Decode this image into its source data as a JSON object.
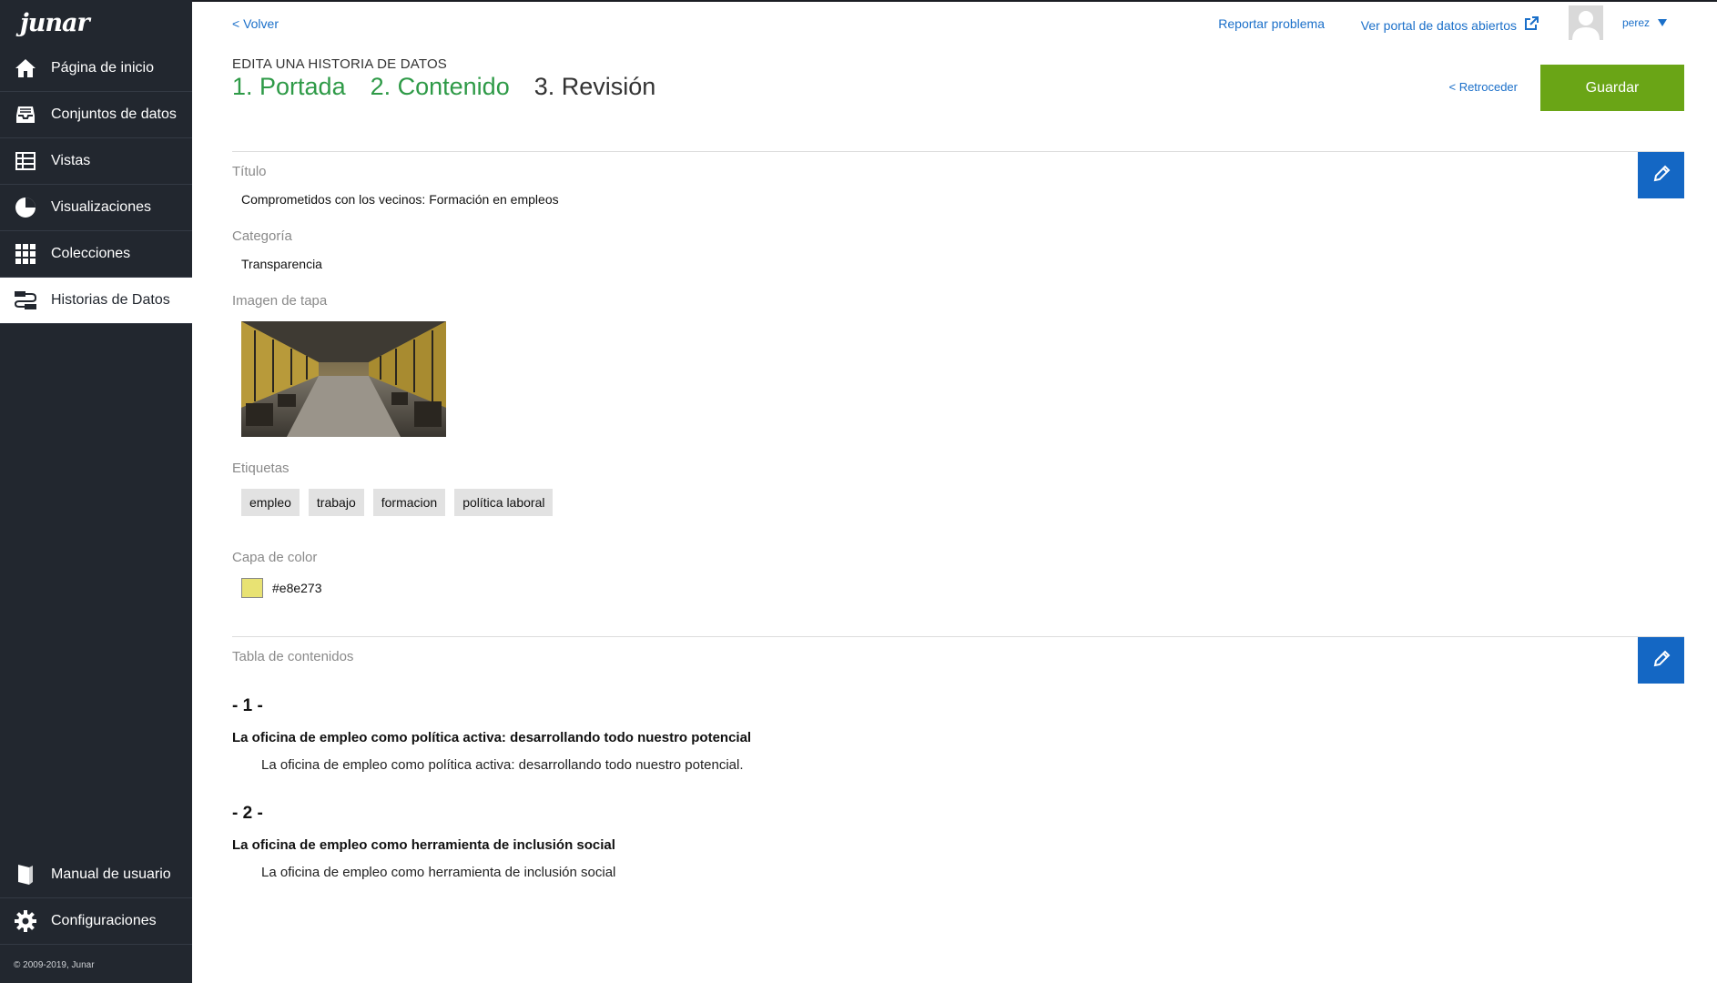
{
  "brand": {
    "logo_text": "junar"
  },
  "sidebar": {
    "items": [
      {
        "label": "Página de inicio",
        "icon": "home-icon"
      },
      {
        "label": "Conjuntos de datos",
        "icon": "inbox-icon"
      },
      {
        "label": "Vistas",
        "icon": "table-icon"
      },
      {
        "label": "Visualizaciones",
        "icon": "pie-chart-icon"
      },
      {
        "label": "Colecciones",
        "icon": "grid-icon"
      },
      {
        "label": "Historias de Datos",
        "icon": "story-icon",
        "active": true
      }
    ],
    "bottom_items": [
      {
        "label": "Manual de usuario",
        "icon": "book-icon"
      },
      {
        "label": "Configuraciones",
        "icon": "gear-icon"
      }
    ],
    "copyright": "© 2009-2019, Junar"
  },
  "header": {
    "back_label": "< Volver",
    "report_label": "Reportar problema",
    "portal_label": "Ver portal de datos abiertos",
    "username": "perez",
    "edit_label": "EDITA UNA HISTORIA DE DATOS",
    "steps": [
      "1. Portada",
      "2. Contenido",
      "3. Revisión"
    ],
    "back_step_label": "< Retroceder",
    "save_label": "Guardar"
  },
  "cover": {
    "title_label": "Título",
    "title_value": "Comprometidos con los vecinos: Formación en empleos",
    "category_label": "Categoría",
    "category_value": "Transparencia",
    "image_label": "Imagen de tapa",
    "tags_label": "Etiquetas",
    "tags": [
      "empleo",
      "trabajo",
      "formacion",
      "política laboral"
    ],
    "color_label": "Capa de color",
    "color_value": "#e8e273"
  },
  "toc": {
    "label": "Tabla de contenidos",
    "entries": [
      {
        "number": "- 1 -",
        "title": "La oficina de empleo como política activa: desarrollando todo nuestro potencial",
        "description": "La oficina de empleo como política activa: desarrollando todo nuestro potencial."
      },
      {
        "number": "- 2 -",
        "title": "La oficina de empleo como herramienta de inclusión social",
        "description": "La oficina de empleo como herramienta de inclusión social"
      }
    ]
  },
  "colors": {
    "accent_green": "#6aa516",
    "link_blue": "#1a6fc9",
    "edit_blue": "#1467c4",
    "sidebar_bg": "#22272f",
    "step_green": "#2e9a47"
  }
}
